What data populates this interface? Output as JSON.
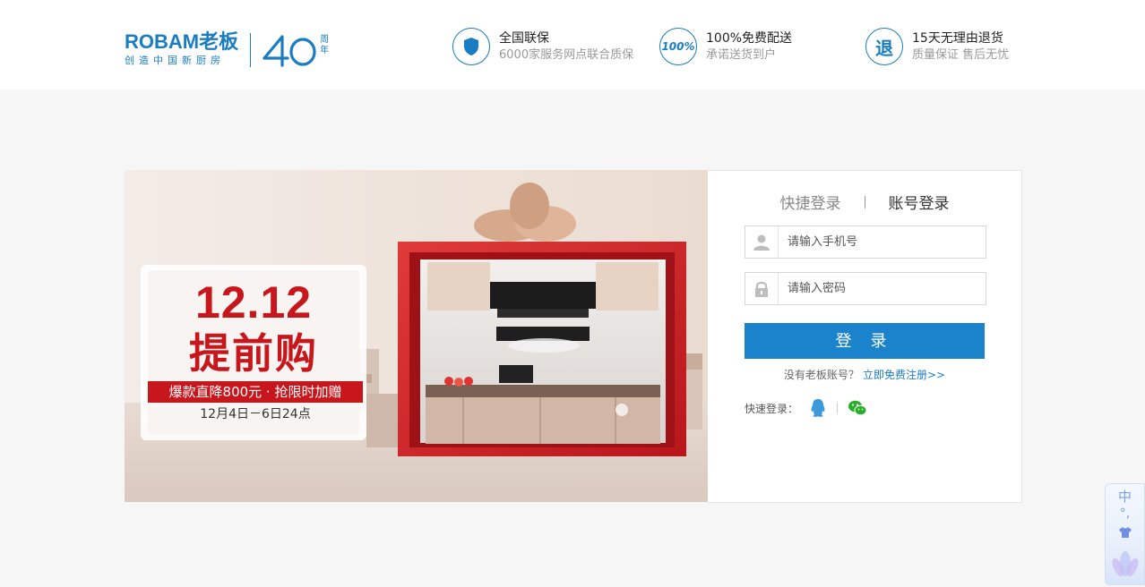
{
  "header": {
    "logo": {
      "brand_en": "ROBAM老板",
      "tagline": "创造中国新厨房",
      "anniversary_number": "40",
      "anniversary_unit_top": "周",
      "anniversary_unit_bottom": "年"
    },
    "promises": [
      {
        "icon": "shield-icon",
        "title": "全国联保",
        "subtitle": "6000家服务网点联合质保"
      },
      {
        "icon": "hundred-percent-icon",
        "icon_text": "100%",
        "title": "100%免费配送",
        "subtitle": "承诺送货到户"
      },
      {
        "icon": "return-icon",
        "icon_text": "退",
        "title": "15天无理由退货",
        "subtitle": "质量保证 售后无忧"
      }
    ]
  },
  "banner": {
    "date_big": "12.12",
    "headline": "提前购",
    "ribbon": "爆款直降800元 · 抢限时加赠",
    "period": "12月4日－6日24点"
  },
  "login": {
    "tabs": [
      {
        "label": "快捷登录",
        "active": false
      },
      {
        "label": "账号登录",
        "active": true
      }
    ],
    "phone_placeholder": "请输入手机号",
    "password_placeholder": "请输入密码",
    "submit_label": "登 录",
    "no_account_text": "没有老板账号？",
    "register_link": "立即免费注册>>",
    "quick_login_label": "快速登录：",
    "quick_login_providers": [
      "qq",
      "wechat"
    ]
  },
  "ime_widget": {
    "mode": "中",
    "punctuation": "°,"
  },
  "colors": {
    "brand_blue": "#1a7cc2",
    "button_blue": "#1a83cc",
    "banner_red": "#c8161d"
  }
}
